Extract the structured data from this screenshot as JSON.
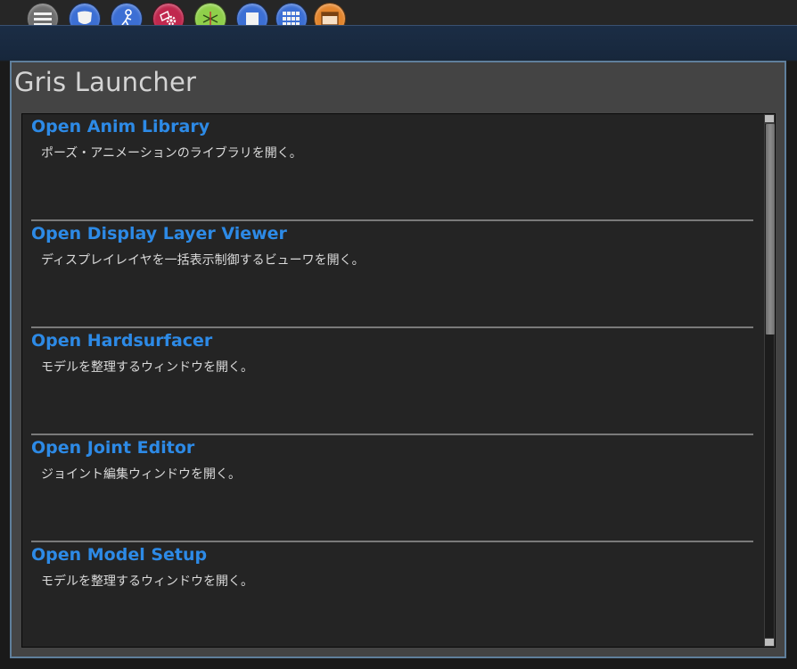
{
  "toolbar": {
    "buttons": [
      {
        "icon": "menu-icon",
        "color": "#6f6f6f"
      },
      {
        "icon": "shield-icon",
        "color": "#3c6fd4"
      },
      {
        "icon": "character-icon",
        "color": "#3c6fd4"
      },
      {
        "icon": "gear-tag-icon",
        "color": "#c0284e"
      },
      {
        "icon": "scissors-icon",
        "color": "#8fcf4a"
      },
      {
        "icon": "cube-icon",
        "color": "#3c6fd4"
      },
      {
        "icon": "grid-icon",
        "color": "#3c6fd4"
      },
      {
        "icon": "window-icon",
        "color": "#e3852d"
      }
    ]
  },
  "launcher": {
    "title": "Gris Launcher",
    "items": [
      {
        "title": "Open Anim Library",
        "description": "ポーズ・アニメーションのライブラリを開く。"
      },
      {
        "title": "Open Display Layer Viewer",
        "description": "ディスプレイレイヤを一括表示制御するビューワを開く。"
      },
      {
        "title": "Open Hardsurfacer",
        "description": "モデルを整理するウィンドウを開く。"
      },
      {
        "title": "Open Joint Editor",
        "description": "ジョイント編集ウィンドウを開く。"
      },
      {
        "title": "Open Model Setup",
        "description": "モデルを整理するウィンドウを開く。"
      }
    ]
  },
  "colors": {
    "item_title": "#2d8ae6",
    "panel_border": "#5f7f9c"
  }
}
